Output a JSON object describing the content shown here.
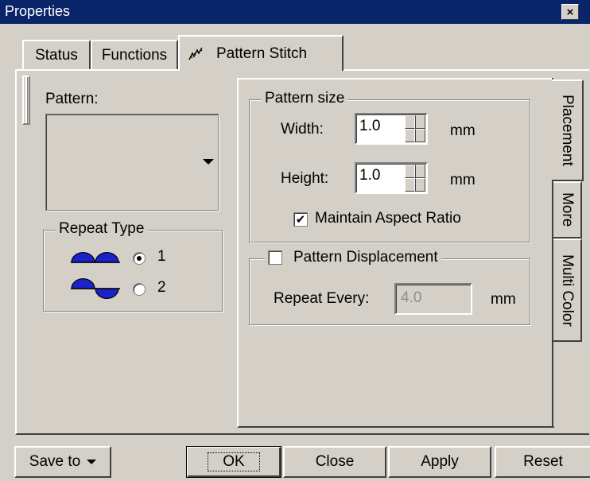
{
  "window": {
    "title": "Properties"
  },
  "tabs": [
    "Status",
    "Functions",
    "Pattern Stitch"
  ],
  "left": {
    "pattern_label": "Pattern:",
    "repeat_type": {
      "label": "Repeat Type",
      "options": [
        "1",
        "2"
      ],
      "selected": "1"
    }
  },
  "side_tabs": [
    "Placement",
    "More",
    "Multi Color"
  ],
  "pattern_size": {
    "label": "Pattern size",
    "width_label": "Width:",
    "width_value": "1.0",
    "height_label": "Height:",
    "height_value": "1.0",
    "unit": "mm",
    "aspect_label": "Maintain Aspect Ratio",
    "aspect_checked": true,
    "aspect_mark": "✔"
  },
  "displacement": {
    "label": "Pattern Displacement",
    "checked": false,
    "repeat_label": "Repeat Every:",
    "repeat_value": "4.0",
    "unit": "mm"
  },
  "buttons": {
    "save": "Save to",
    "ok": "OK",
    "close": "Close",
    "apply": "Apply",
    "reset": "Reset"
  },
  "icons": {
    "close": "×",
    "pattern_tab": "stitch-icon"
  },
  "colors": {
    "titlebar": "#0a246a",
    "face": "#d4d0c8",
    "repeat_icon": "#1a22c8"
  }
}
